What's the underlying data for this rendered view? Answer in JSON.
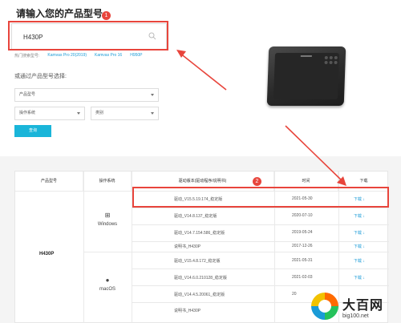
{
  "header": {
    "title": "请输入您的产品型号.",
    "step_badge_1": "1"
  },
  "search": {
    "value": "H430P"
  },
  "hot": {
    "label": "热门搜索型号:",
    "items": [
      "Kamvas Pro 20(2019)",
      "Kamvas Pro 16",
      "H950P"
    ]
  },
  "select_section": {
    "label": "或通过产品型号选择:",
    "model_select": "产品型号",
    "os_select": "操作系统",
    "category_select": "类别",
    "query_button": "查询"
  },
  "table": {
    "headers": [
      "产品型号",
      "操作系统",
      "驱动版本(驱动程序/说明书)",
      "时间",
      "下载"
    ],
    "step_badge_2": "2",
    "model": "H430P",
    "windows_label": "Windows",
    "macos_label": "macOS",
    "rows": [
      {
        "version": "驱动_V15.5.19.174_稳定版",
        "date": "2021-05-30",
        "download": "下载 ↓"
      },
      {
        "version": "驱动_V14.8.137_稳定版",
        "date": "2020-07-10",
        "download": "下载 ↓"
      },
      {
        "version": "驱动_V14.7.154.586_稳定版",
        "date": "2019-05-24",
        "download": "下载 ↓"
      },
      {
        "version": "说明书_H430P",
        "date": "2017-12-26",
        "download": "下载 ↓"
      },
      {
        "version": "驱动_V15.4.8.172_稳定版",
        "date": "2021-05-31",
        "download": "下载 ↓"
      },
      {
        "version": "驱动_V14.6.0.210128_稳定版",
        "date": "2021-02-03",
        "download": "下载 ↓"
      },
      {
        "version": "驱动_V14.4.5.20061_稳定版",
        "date": "20",
        "download": ""
      },
      {
        "version": "说明书_H430P",
        "date": "",
        "download": ""
      }
    ]
  },
  "watermark": {
    "title": "大百网",
    "sub": "big100.net"
  },
  "colors": {
    "accent": "#1a9bd7",
    "button": "#1ab5d9",
    "highlight": "#e8453c"
  }
}
